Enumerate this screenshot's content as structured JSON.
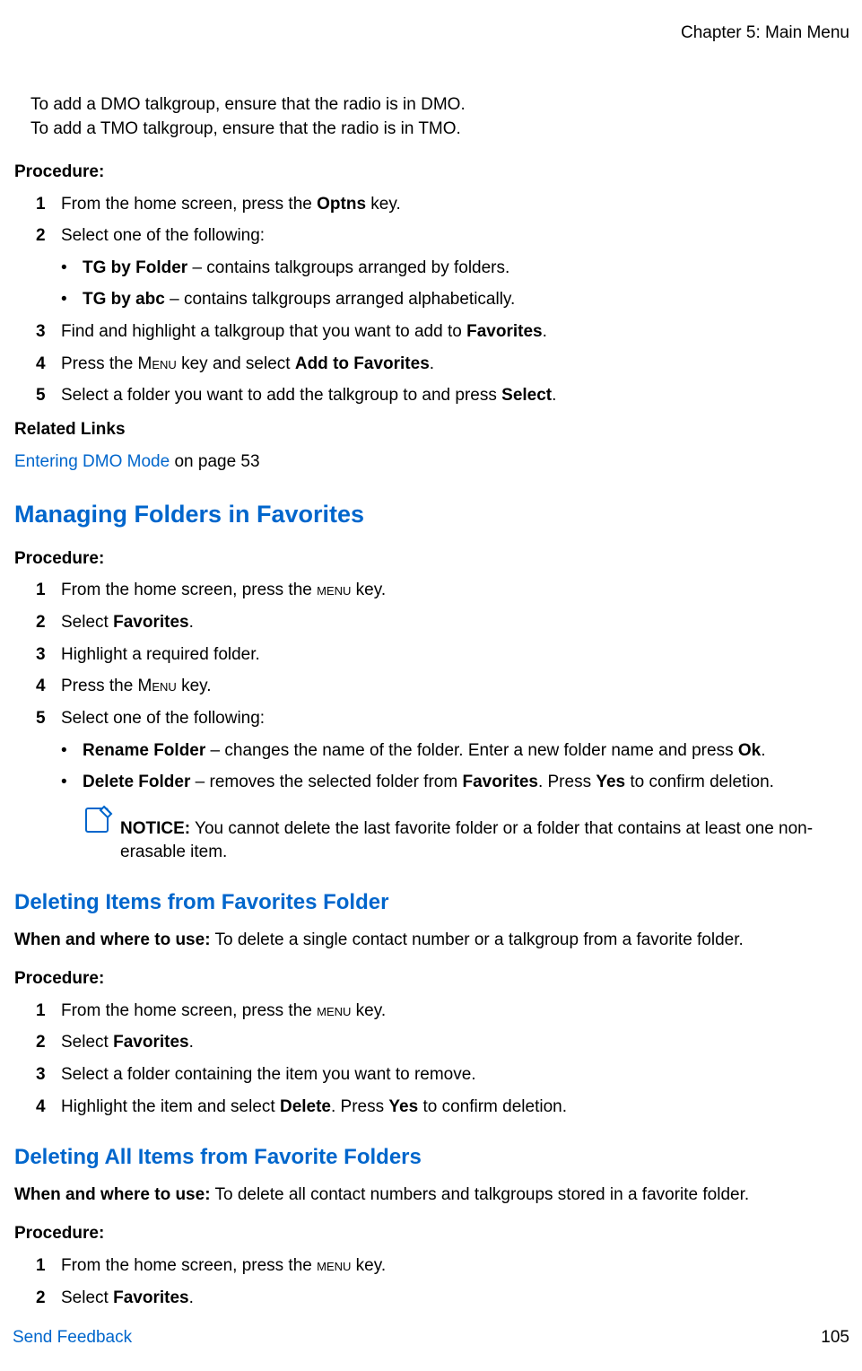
{
  "header": {
    "chapter": "Chapter 5: Main Menu"
  },
  "intro": {
    "line1": "To add a DMO talkgroup, ensure that the radio is in DMO.",
    "line2": "To add a TMO talkgroup, ensure that the radio is in TMO."
  },
  "labels": {
    "procedure": "Procedure:",
    "related": "Related Links",
    "notice": "NOTICE:",
    "when": "When and where to use:"
  },
  "sec0": {
    "step1_pre": "From the home screen, press the ",
    "step1_bold": "Optns",
    "step1_post": " key.",
    "step2": "Select one of the following:",
    "b1_bold": "TG by Folder",
    "b1_post": " – contains talkgroups arranged by folders.",
    "b2_bold": "TG by abc",
    "b2_post": " – contains talkgroups arranged alphabetically.",
    "step3_pre": "Find and highlight a talkgroup that you want to add to ",
    "step3_bold": "Favorites",
    "step3_post": ".",
    "step4_pre": "Press the ",
    "step4_sc": "Menu",
    "step4_mid": " key and select ",
    "step4_bold": "Add to Favorites",
    "step4_post": ".",
    "step5_pre": "Select a folder you want to add the talkgroup to and press ",
    "step5_bold": "Select",
    "step5_post": ".",
    "link_text": "Entering DMO Mode",
    "link_post": " on page 53"
  },
  "sec1": {
    "title": "Managing Folders in Favorites",
    "step1_pre": "From the home screen, press the ",
    "step1_sc": "menu",
    "step1_post": " key.",
    "step2_pre": "Select ",
    "step2_bold": "Favorites",
    "step2_post": ".",
    "step3": "Highlight a required folder.",
    "step4_pre": "Press the ",
    "step4_sc": "Menu",
    "step4_post": " key.",
    "step5": "Select one of the following:",
    "b1_bold": "Rename Folder",
    "b1_mid": " – changes the name of the folder. Enter a new folder name and press ",
    "b1_bold2": "Ok",
    "b1_post": ".",
    "b2_bold": "Delete Folder",
    "b2_mid": " – removes the selected folder from ",
    "b2_bold2": "Favorites",
    "b2_mid2": ". Press ",
    "b2_bold3": "Yes",
    "b2_post": " to confirm deletion.",
    "notice_text": " You cannot delete the last favorite folder or a folder that contains at least one non-erasable item."
  },
  "sec2": {
    "title": "Deleting Items from Favorites Folder",
    "when": " To delete a single contact number or a talkgroup from a favorite folder.",
    "step1_pre": "From the home screen, press the ",
    "step1_sc": "menu",
    "step1_post": " key.",
    "step2_pre": "Select ",
    "step2_bold": "Favorites",
    "step2_post": ".",
    "step3": "Select a folder containing the item you want to remove.",
    "step4_pre": "Highlight the item and select ",
    "step4_bold": "Delete",
    "step4_mid": ". Press ",
    "step4_bold2": "Yes",
    "step4_post": " to confirm deletion."
  },
  "sec3": {
    "title": "Deleting All Items from Favorite Folders",
    "when": " To delete all contact numbers and talkgroups stored in a favorite folder.",
    "step1_pre": "From the home screen, press the ",
    "step1_sc": "menu",
    "step1_post": " key.",
    "step2_pre": "Select ",
    "step2_bold": "Favorites",
    "step2_post": "."
  },
  "footer": {
    "feedback": "Send Feedback",
    "page": "105"
  },
  "nums": {
    "n1": "1",
    "n2": "2",
    "n3": "3",
    "n4": "4",
    "n5": "5"
  },
  "bullet": "•"
}
